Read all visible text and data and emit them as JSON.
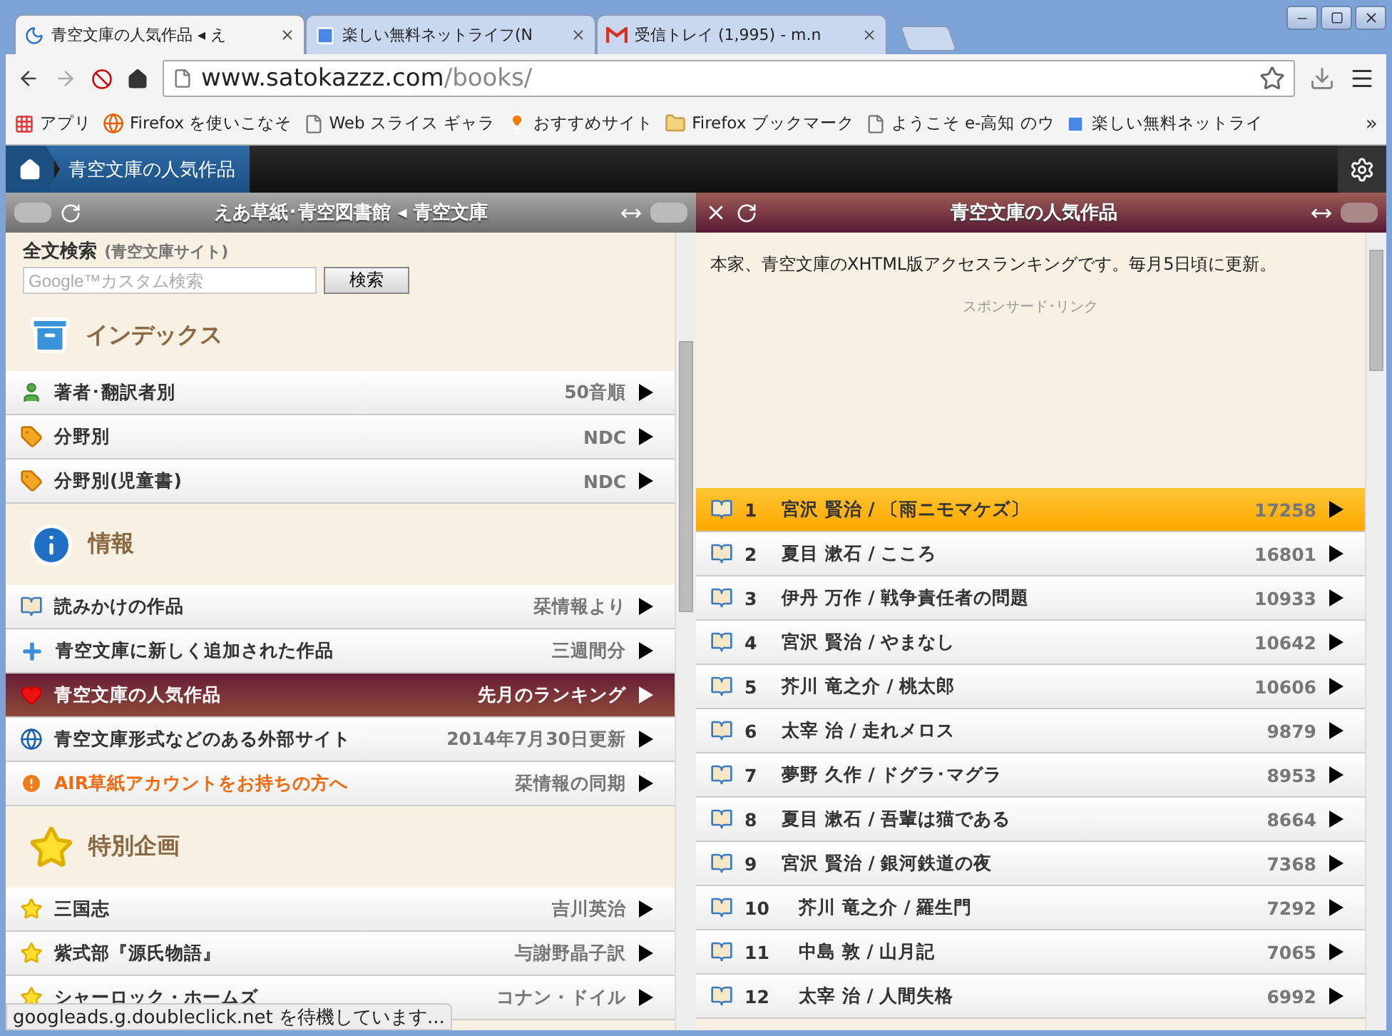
{
  "browser": {
    "tabs": [
      {
        "title": "青空文庫の人気作品 ◂ え",
        "kind": "moon",
        "selected": true
      },
      {
        "title": "楽しい無料ネットライフ(N",
        "kind": "google",
        "selected": false
      },
      {
        "title": "受信トレイ (1,995) - m.n",
        "kind": "gmail",
        "selected": false
      }
    ],
    "url": {
      "host": "www.satokazzz.com",
      "path": "/books/"
    },
    "bookmarks": [
      {
        "label": "アプリ",
        "kind": "apps"
      },
      {
        "label": "Firefox を使いこなそ",
        "kind": "firefox"
      },
      {
        "label": "Web スライス ギャラ",
        "kind": "page"
      },
      {
        "label": "おすすめサイト",
        "kind": "bulb"
      },
      {
        "label": "Firefox ブックマーク",
        "kind": "folder"
      },
      {
        "label": "ようこそ e-高知 のウ",
        "kind": "page"
      },
      {
        "label": "楽しい無料ネットライ",
        "kind": "google"
      }
    ],
    "bookmarks_more": "»",
    "status": "googleads.g.doubleclick.net を待機しています..."
  },
  "app_header": {
    "breadcrumb": "青空文庫の人気作品"
  },
  "left_pane": {
    "title": "えあ草紙･青空図書館 ◂ 青空文庫",
    "search": {
      "heading": "全文検索",
      "subheading": "(青空文庫サイト)",
      "placeholder": "Google™カスタム検索",
      "button": "検索"
    },
    "sections": [
      {
        "title": "インデックス",
        "kind": "cabinet",
        "items": [
          {
            "label": "著者･翻訳者別",
            "note": "50音順",
            "kind": "person",
            "selected": false
          },
          {
            "label": "分野別",
            "note": "NDC",
            "kind": "tag",
            "selected": false
          },
          {
            "label": "分野別(児童書)",
            "note": "NDC",
            "kind": "tag",
            "selected": false
          }
        ]
      },
      {
        "title": "情報",
        "kind": "info",
        "items": [
          {
            "label": "読みかけの作品",
            "note": "栞情報より",
            "kind": "book",
            "selected": false
          },
          {
            "label": "青空文庫に新しく追加された作品",
            "note": "三週間分",
            "kind": "plus",
            "selected": false
          },
          {
            "label": "青空文庫の人気作品",
            "note": "先月のランキング",
            "kind": "heart",
            "selected": true
          },
          {
            "label": "青空文庫形式などのある外部サイト",
            "note": "2014年7月30日更新",
            "kind": "globe",
            "selected": false
          },
          {
            "label": "AIR草紙アカウントをお持ちの方へ",
            "note": "栞情報の同期",
            "kind": "alert",
            "selected": false
          }
        ]
      },
      {
        "title": "特別企画",
        "kind": "star",
        "items": [
          {
            "label": "三国志",
            "note": "吉川英治",
            "kind": "star",
            "selected": false
          },
          {
            "label": "紫式部『源氏物語』",
            "note": "与謝野晶子訳",
            "kind": "star",
            "selected": false
          },
          {
            "label": "シャーロック・ホームズ",
            "note": "コナン・ドイル",
            "kind": "star",
            "selected": false
          }
        ]
      }
    ]
  },
  "right_pane": {
    "title": "青空文庫の人気作品",
    "description": "本家、青空文庫のXHTML版アクセスランキングです。毎月5日頃に更新。",
    "sponsor": "スポンサード･リンク",
    "ranking": [
      {
        "rank": "1",
        "work": "宮沢 賢治 / 〔雨ニモマケズ〕",
        "count": "17258",
        "selected": true
      },
      {
        "rank": "2",
        "work": "夏目 漱石 / こころ",
        "count": "16801",
        "selected": false
      },
      {
        "rank": "3",
        "work": "伊丹 万作 / 戦争責任者の問題",
        "count": "10933",
        "selected": false
      },
      {
        "rank": "4",
        "work": "宮沢 賢治 / やまなし",
        "count": "10642",
        "selected": false
      },
      {
        "rank": "5",
        "work": "芥川 竜之介 / 桃太郎",
        "count": "10606",
        "selected": false
      },
      {
        "rank": "6",
        "work": "太宰 治 / 走れメロス",
        "count": "9879",
        "selected": false
      },
      {
        "rank": "7",
        "work": "夢野 久作 / ドグラ･マグラ",
        "count": "8953",
        "selected": false
      },
      {
        "rank": "8",
        "work": "夏目 漱石 / 吾輩は猫である",
        "count": "8664",
        "selected": false
      },
      {
        "rank": "9",
        "work": "宮沢 賢治 / 銀河鉄道の夜",
        "count": "7368",
        "selected": false
      },
      {
        "rank": "10",
        "work": "芥川 竜之介 / 羅生門",
        "count": "7292",
        "selected": false
      },
      {
        "rank": "11",
        "work": "中島 敦 / 山月記",
        "count": "7065",
        "selected": false
      },
      {
        "rank": "12",
        "work": "太宰 治 / 人間失格",
        "count": "6992",
        "selected": false
      }
    ]
  }
}
